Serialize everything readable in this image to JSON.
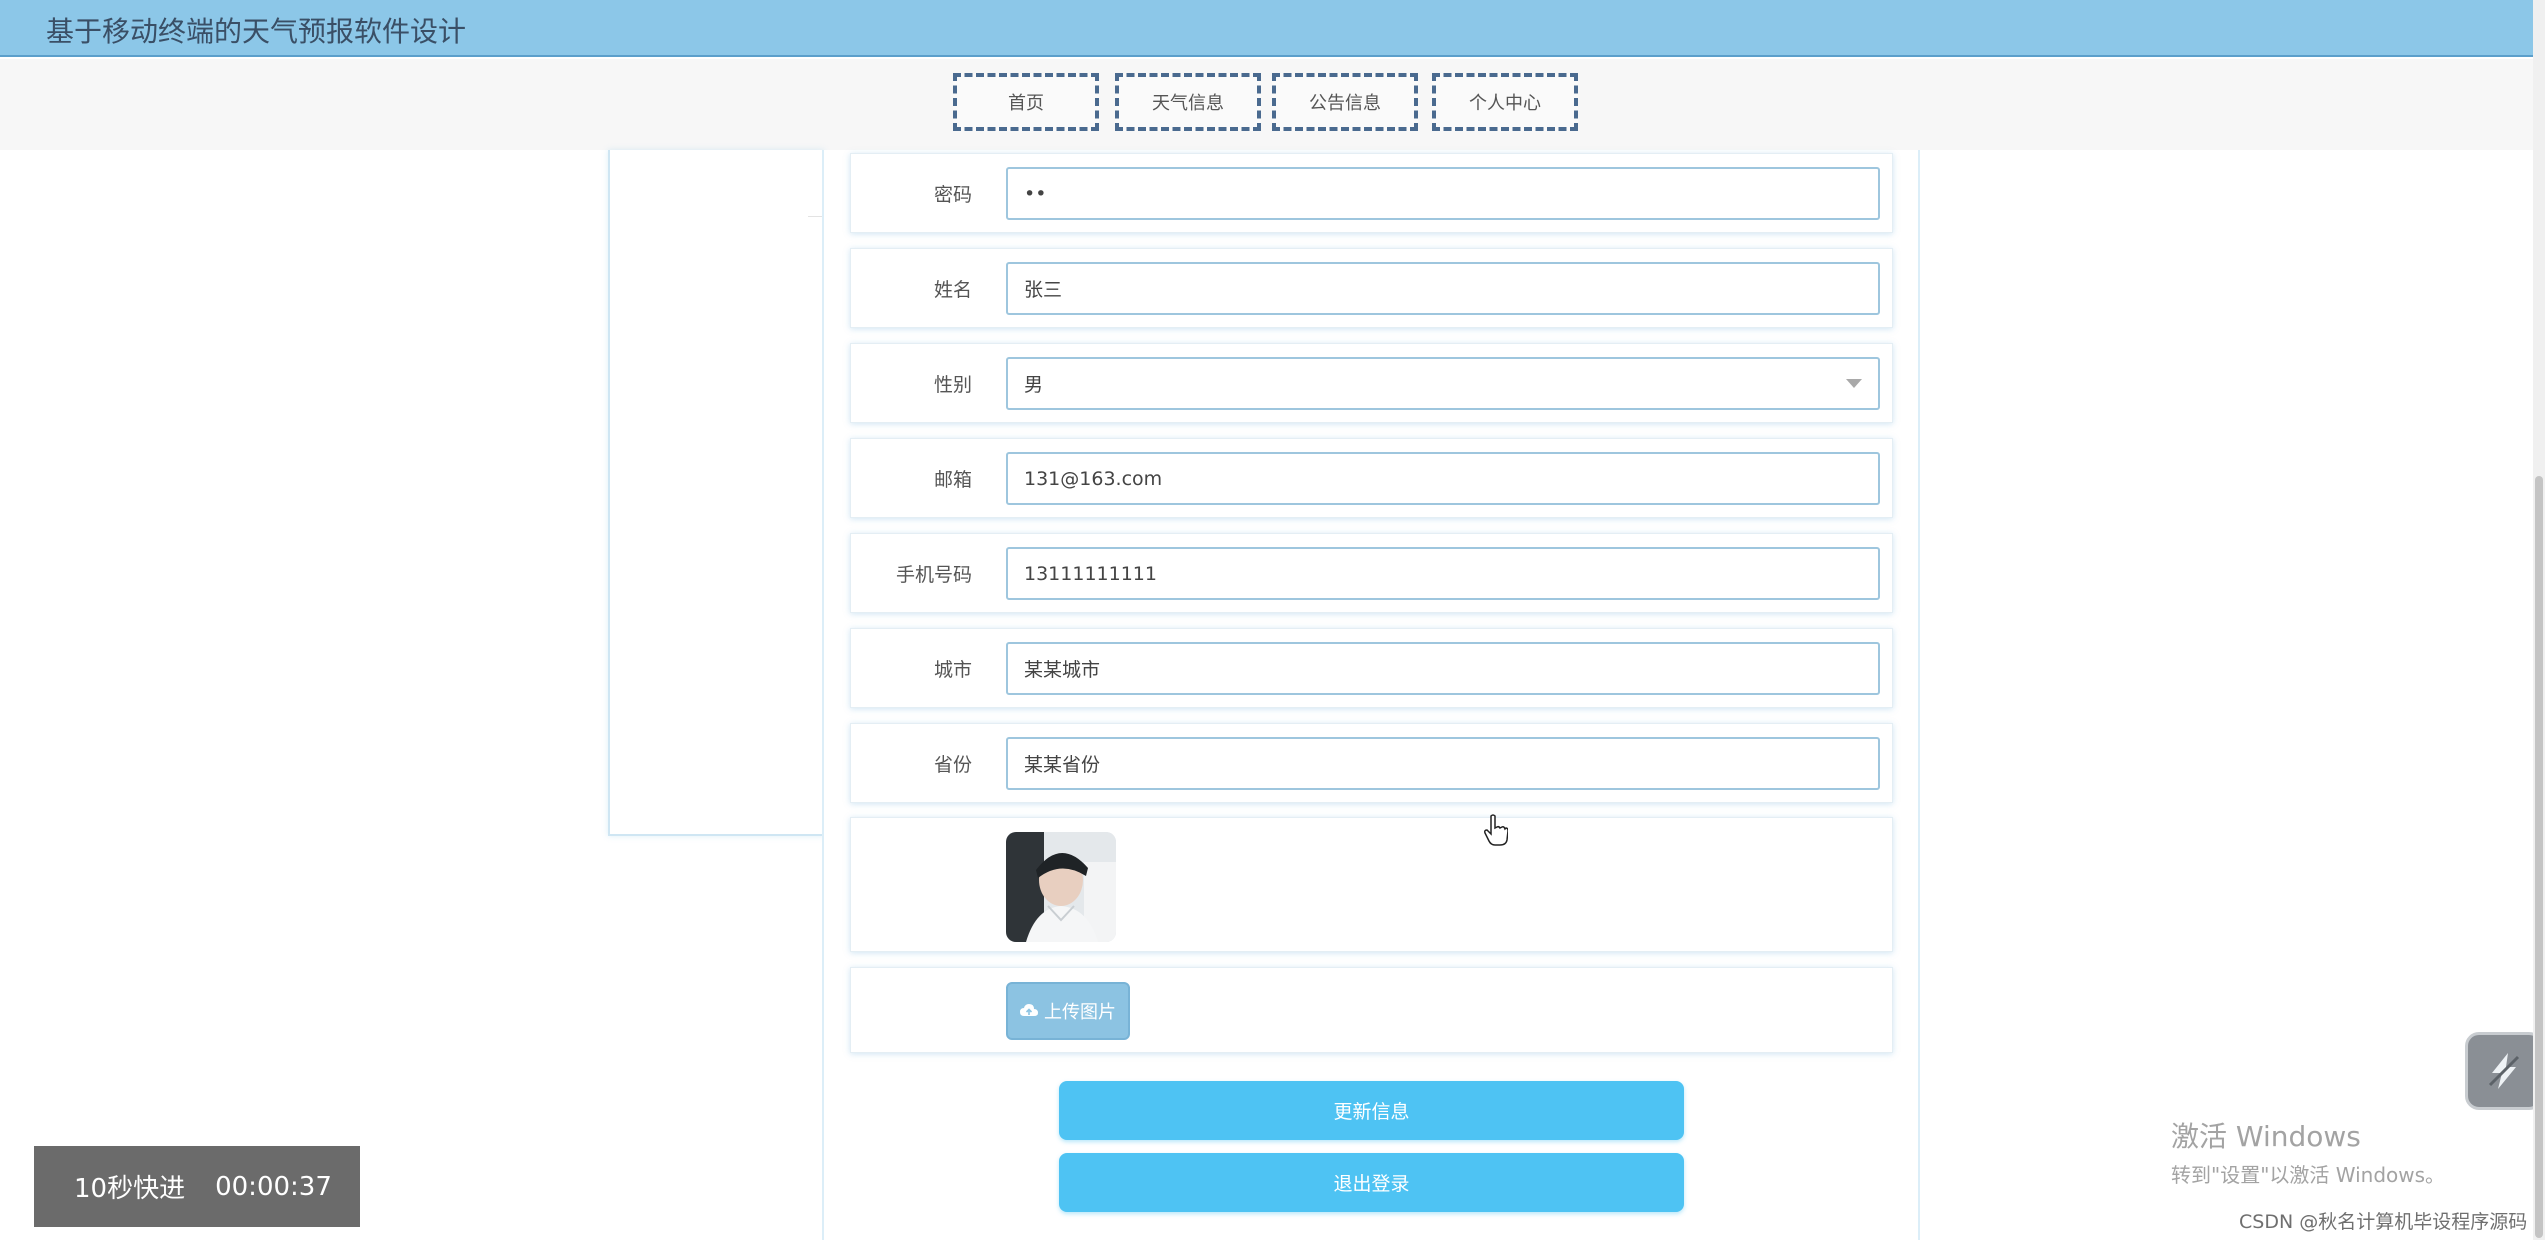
{
  "header": {
    "title": "基于移动终端的天气预报软件设计"
  },
  "nav": {
    "items": [
      "首页",
      "天气信息",
      "公告信息",
      "个人中心"
    ]
  },
  "form": {
    "password_label": "密码",
    "password_value": "••",
    "name_label": "姓名",
    "name_value": "张三",
    "gender_label": "性别",
    "gender_value": "男",
    "email_label": "邮箱",
    "email_value": "131@163.com",
    "phone_label": "手机号码",
    "phone_value": "13111111111",
    "city_label": "城市",
    "city_value": "某某城市",
    "province_label": "省份",
    "province_value": "某某省份",
    "upload_label": "上传图片"
  },
  "actions": {
    "update_label": "更新信息",
    "logout_label": "退出登录"
  },
  "player": {
    "skip_label": "10秒快进",
    "timestamp": "00:00:37"
  },
  "os": {
    "activate_title": "激活 Windows",
    "activate_hint": "转到\"设置\"以激活 Windows。"
  },
  "watermark": "CSDN @秋名计算机毕设程序源码",
  "colors": {
    "header_bg": "#8cc7e8",
    "primary_button": "#4ec3f3",
    "upload_button": "#8cc3e2",
    "nav_border": "#4a6a8f"
  },
  "icons": {
    "upload": "cloud-upload-icon",
    "float": "lightning-icon",
    "cursor": "hand-cursor-icon"
  }
}
